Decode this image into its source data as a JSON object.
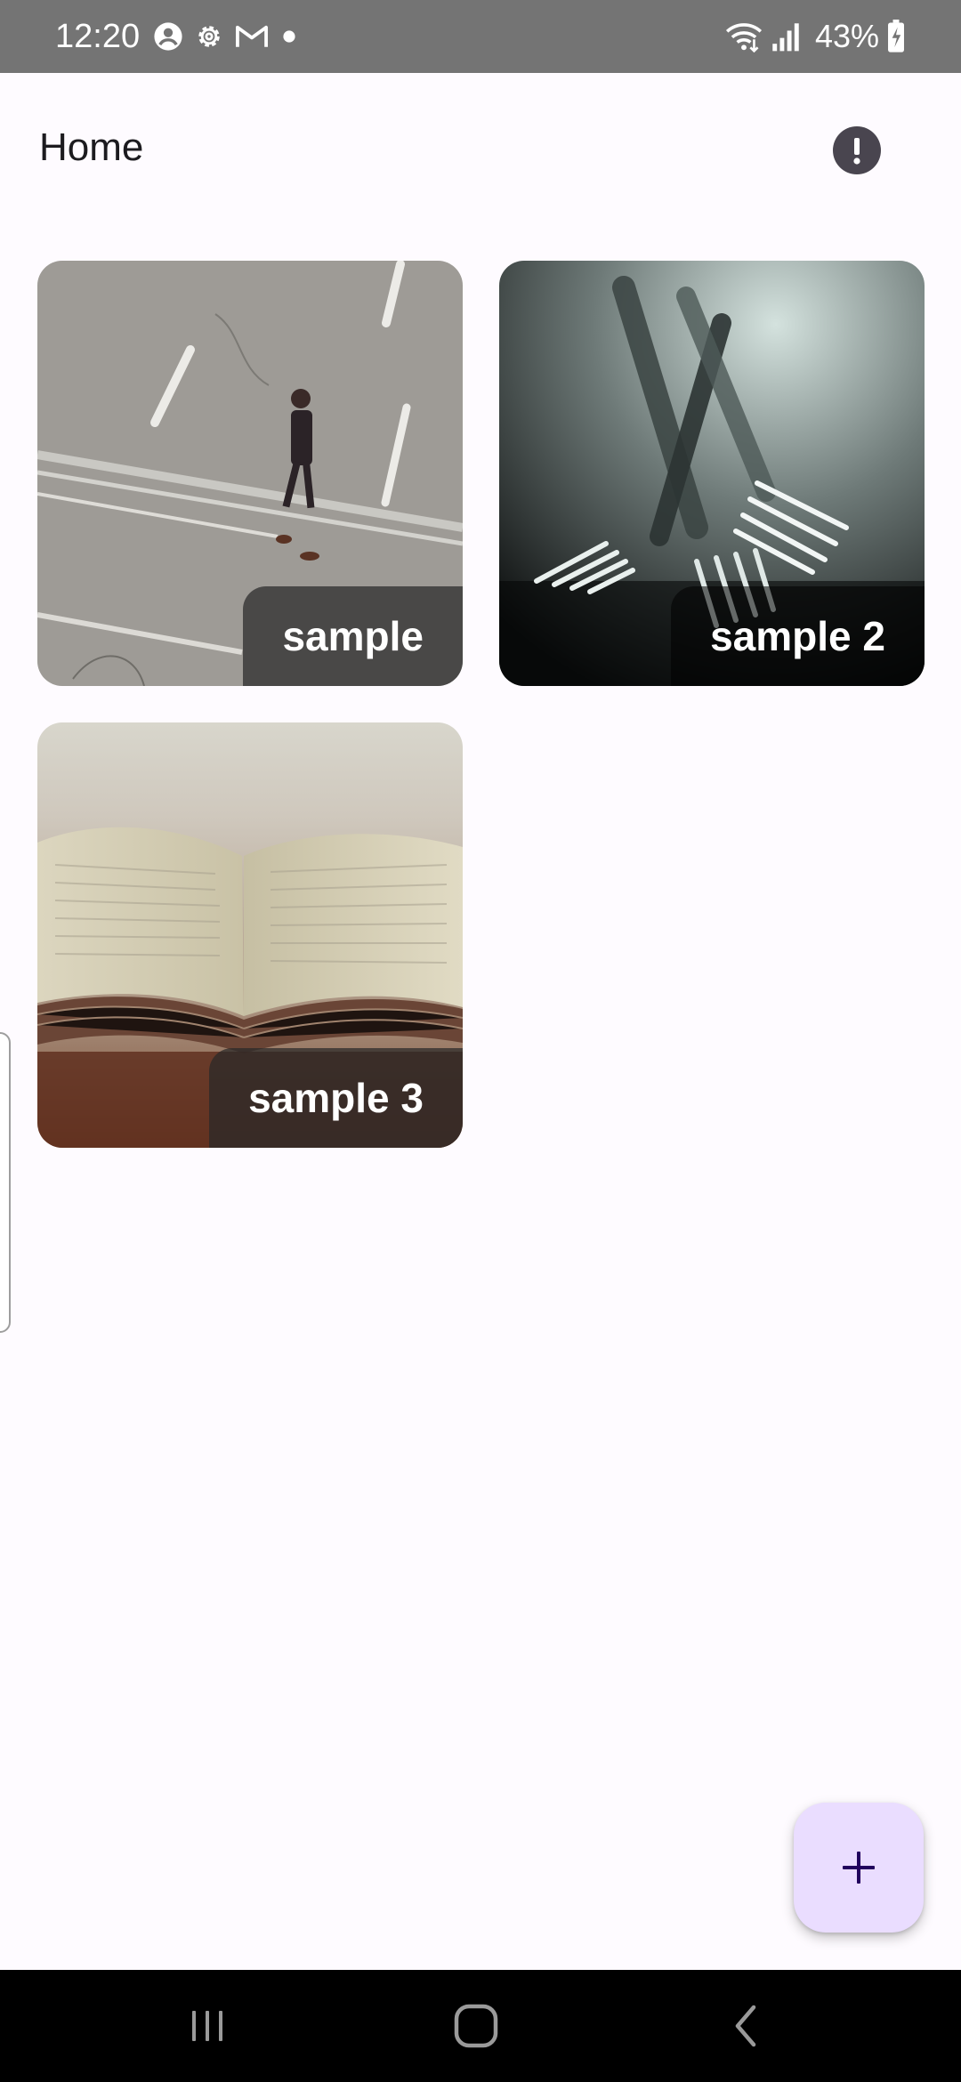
{
  "status_bar": {
    "time": "12:20",
    "battery": "43%",
    "icons": [
      "account-circle-icon",
      "settings-gear-icon",
      "gmail-icon",
      "notification-dot-icon",
      "wifi-icon",
      "signal-icon",
      "battery-charging-icon"
    ]
  },
  "app_bar": {
    "title": "Home",
    "action_icon": "info-alert-icon"
  },
  "grid": {
    "items": [
      {
        "label": "sample",
        "image": "person-walking-on-street"
      },
      {
        "label": "sample 2",
        "image": "crossed-forks"
      },
      {
        "label": "sample 3",
        "image": "open-book"
      }
    ]
  },
  "fab": {
    "icon": "plus-icon"
  },
  "nav_bar": {
    "buttons": [
      "recents-icon",
      "home-icon",
      "back-icon"
    ]
  },
  "colors": {
    "background": "#fefbff",
    "status_bar": "#747474",
    "fab": "#eaddff",
    "fab_icon": "#21005d",
    "info_icon_bg": "#49454f",
    "nav_bar": "#000000"
  }
}
